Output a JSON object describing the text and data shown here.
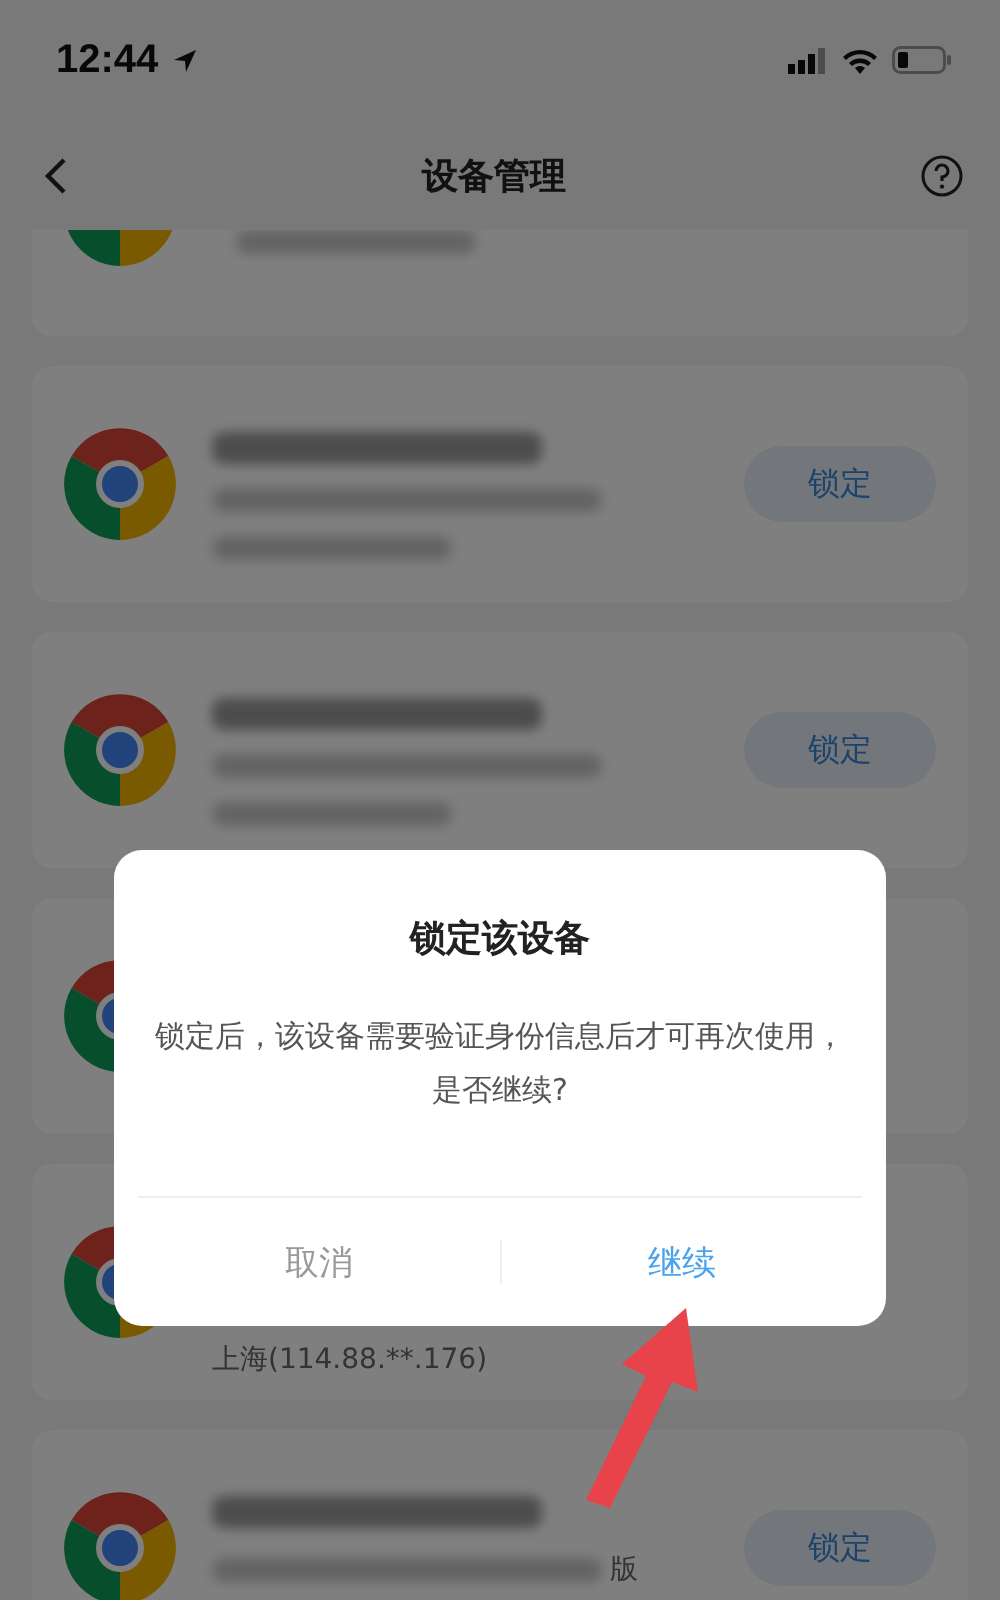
{
  "status_bar": {
    "time": "12:44"
  },
  "nav_bar": {
    "title": "设备管理"
  },
  "devices": [
    {
      "kind": "browser",
      "lock_button": "锁定"
    },
    {
      "kind": "browser",
      "lock_button": "锁定"
    },
    {
      "kind": "browser"
    },
    {
      "kind": "browser",
      "location": "上海(114.88.**.176)"
    },
    {
      "kind": "browser",
      "detail_tail": "版",
      "lock_button": "锁定"
    }
  ],
  "dialog": {
    "title": "锁定该设备",
    "message": "锁定后，该设备需要验证身份信息后才可再次使用，是否继续?",
    "buttons": [
      {
        "label": "取消",
        "kind": "cancel"
      },
      {
        "label": "继续",
        "kind": "confirm"
      }
    ]
  },
  "pointer_arrow": {
    "kind": "arrow"
  }
}
